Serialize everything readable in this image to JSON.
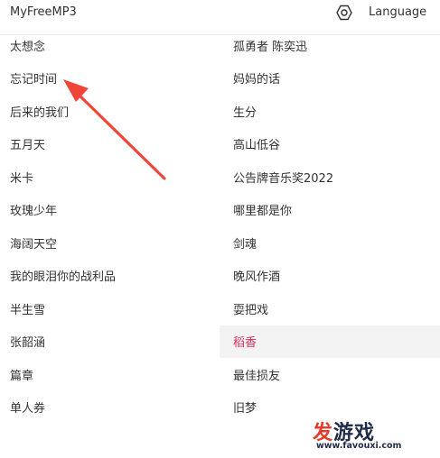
{
  "header": {
    "brand": "MyFreeMP3",
    "settings_icon": "gear-hexagon-icon",
    "language": "Language"
  },
  "songs": [
    {
      "left": "太想念",
      "right": "孤勇者 陈奕迅"
    },
    {
      "left": "忘记时间",
      "right": "妈妈的话"
    },
    {
      "left": "后来的我们",
      "right": "生分"
    },
    {
      "left": "五月天",
      "right": "高山低谷"
    },
    {
      "left": "米卡",
      "right": "公告牌音乐奖2022"
    },
    {
      "left": "玫瑰少年",
      "right": "哪里都是你"
    },
    {
      "left": "海阔天空",
      "right": "剑魂"
    },
    {
      "left": "我的眼泪你的战利品",
      "right": "晚风作酒"
    },
    {
      "left": "半生雪",
      "right": "耍把戏"
    },
    {
      "left": "张韶涵",
      "right": "稻香"
    },
    {
      "left": "篇章",
      "right": "最佳损友"
    },
    {
      "left": "单人券",
      "right": "旧梦"
    }
  ],
  "active_song": "稻香",
  "colors": {
    "active_text": "#e0325f",
    "active_bg": "#f3f3f3",
    "arrow": "#f0463a",
    "watermark_red": "#e83b27",
    "watermark_navy": "#1f2b4a"
  },
  "watermark": {
    "char1": "发",
    "char2": "游戏",
    "url": "www.favouxi.com"
  }
}
